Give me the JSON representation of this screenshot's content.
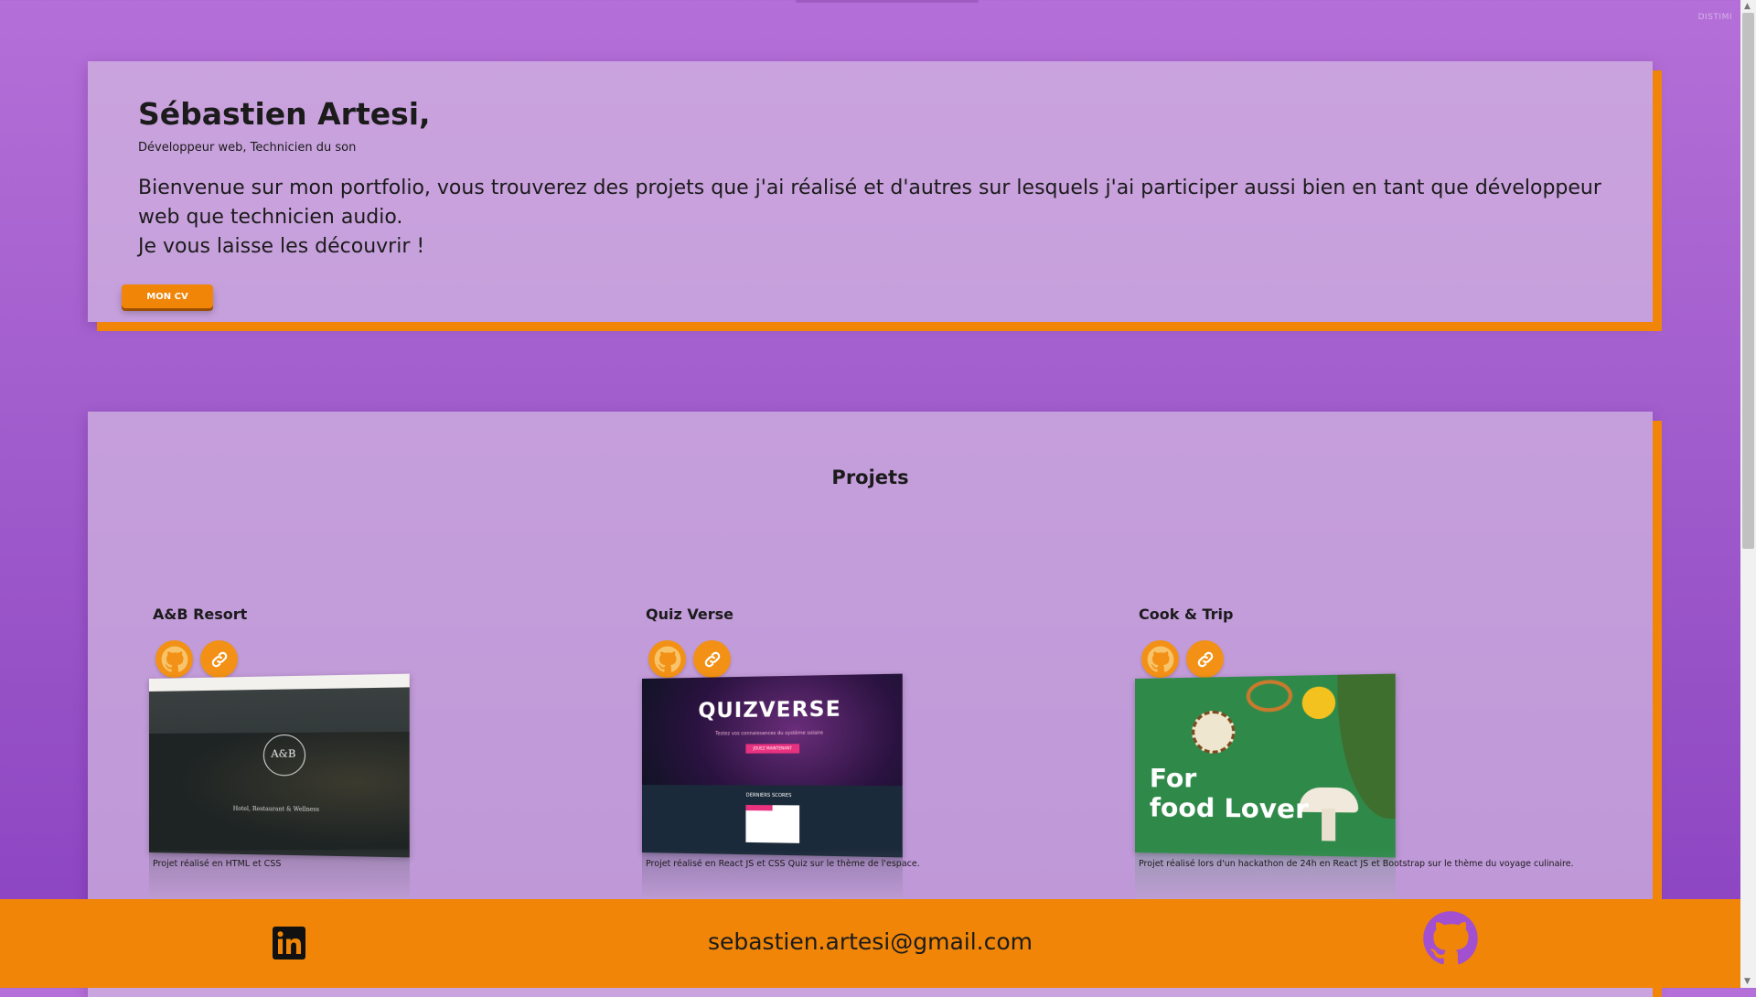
{
  "topbar": {
    "hint": "DISTIMI"
  },
  "intro": {
    "name": "Sébastien Artesi,",
    "subtitle": "Développeur web, Technicien du son",
    "paragraph_line1": "Bienvenue sur mon portfolio, vous trouverez des projets que j'ai réalisé et d'autres sur lesquels j'ai participer aussi bien en tant que développeur web que technicien audio.",
    "paragraph_line2": "Je vous laisse les découvrir !",
    "cv_button": "MON CV"
  },
  "projects": {
    "heading": "Projets",
    "items": [
      {
        "title": "A&B Resort",
        "description": "Projet réalisé en HTML et CSS",
        "thumb_logo": "A&B",
        "thumb_tagline": "Hotel, Restaurant & Wellness"
      },
      {
        "title": "Quiz Verse",
        "description": "Projet réalisé en React JS et CSS Quiz sur le thème de l'espace.",
        "thumb_logo": "QUIZVERSE",
        "thumb_tagline": "Testez vos connaissances du système solaire",
        "thumb_button": "JOUEZ MAINTENANT",
        "thumb_section": "DERNIERS SCORES"
      },
      {
        "title": "Cook & Trip",
        "description": "Projet réalisé lors d'un hackathon de 24h en React JS et Bootstrap sur le thème du voyage culinaire.",
        "thumb_headline_1": "For",
        "thumb_headline_2": "food Lover"
      }
    ],
    "icons": {
      "repo": "github-icon",
      "site": "link-icon"
    }
  },
  "footer": {
    "email": "sebastien.artesi@gmail.com",
    "linkedin_icon": "linkedin-icon",
    "github_icon": "github-icon"
  },
  "colors": {
    "accent": "#f08508",
    "background": "#a05ccc",
    "card": "#d2b9e1"
  }
}
